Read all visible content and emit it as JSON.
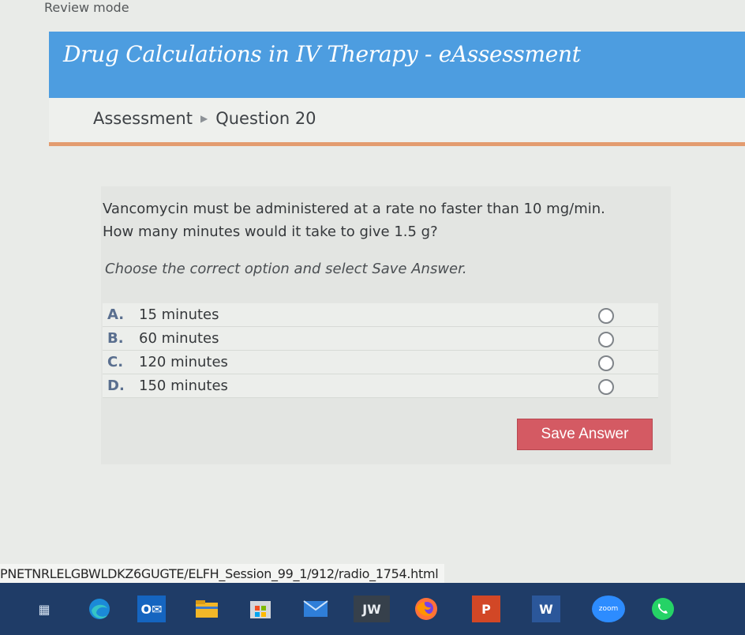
{
  "page": {
    "review_mode": "Review mode",
    "title": "Drug Calculations in IV Therapy - eAssessment"
  },
  "breadcrumb": {
    "items": [
      "Assessment",
      "Question 20"
    ]
  },
  "question": {
    "text": "Vancomycin must be administered at a rate no faster than 10 mg/min. How many minutes would it take to give 1.5 g?",
    "instruction": "Choose the correct option and select Save Answer.",
    "options": [
      {
        "letter": "A.",
        "label": "15 minutes"
      },
      {
        "letter": "B.",
        "label": "60 minutes"
      },
      {
        "letter": "C.",
        "label": "120 minutes"
      },
      {
        "letter": "D.",
        "label": "150 minutes"
      }
    ],
    "save_label": "Save Answer"
  },
  "status_bar": {
    "url": "PNETNRLELGBWLDKZ6GUGTE/ELFH_Session_99_1/912/radio_1754.html"
  },
  "taskbar": {
    "jw_label": "JW",
    "powerpoint_label": "P",
    "word_label": "W",
    "zoom_label": "zoom"
  },
  "colors": {
    "header": "#4d9de0",
    "accent_rule": "#e39c70",
    "save_button": "#d45a63",
    "option_letter": "#5a6f8f"
  }
}
